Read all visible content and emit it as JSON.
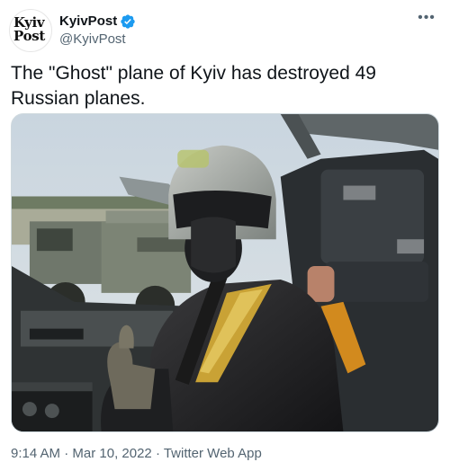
{
  "account": {
    "logo_line1": "Kyiv",
    "logo_line2": "Post",
    "display_name": "KyivPost",
    "handle": "@KyivPost",
    "verified": true
  },
  "tweet": {
    "text": "The \"Ghost\" plane of Kyiv has destroyed 49 Russian planes."
  },
  "footer": {
    "time": "9:14 AM",
    "separator": " · ",
    "date": "Mar 10, 2022",
    "source": "Twitter Web App"
  },
  "icons": {
    "more": "more-options-icon",
    "verified": "verified-badge-icon"
  },
  "colors": {
    "verified_blue": "#1d9bf0",
    "muted_text": "#536471",
    "primary_text": "#0f1419"
  }
}
